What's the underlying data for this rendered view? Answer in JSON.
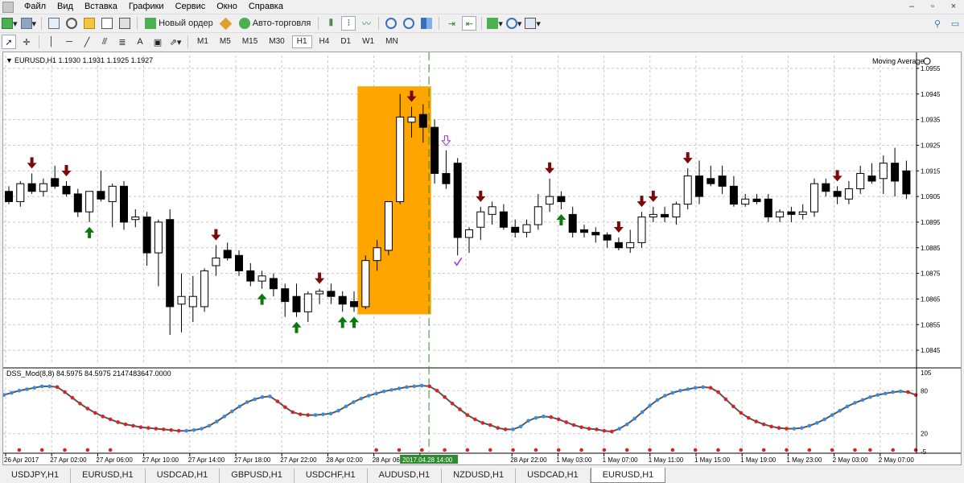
{
  "menu": {
    "items": [
      "Файл",
      "Вид",
      "Вставка",
      "Графики",
      "Сервис",
      "Окно",
      "Справка"
    ],
    "window_controls": [
      "–",
      "▫",
      "×"
    ]
  },
  "toolbar1": {
    "new_order": "Новый ордер",
    "auto_trading": "Авто-торговля"
  },
  "toolbar2": {
    "timeframes": [
      "M1",
      "M5",
      "M15",
      "M30",
      "H1",
      "H4",
      "D1",
      "W1",
      "MN"
    ],
    "active_timeframe": "H1"
  },
  "chart": {
    "header": "EURUSD,H1  1.1930 1.1931 1.1925 1.1927",
    "indicator_label": "Moving Average",
    "price_labels": [
      "1.0955",
      "1.0945",
      "1.0935",
      "1.0925",
      "1.0915",
      "1.0905",
      "1.0895",
      "1.0885",
      "1.0875",
      "1.0865",
      "1.0855",
      "1.0845"
    ],
    "time_labels": [
      "26 Apr 2017",
      "27 Apr 02:00",
      "27 Apr 06:00",
      "27 Apr 10:00",
      "27 Apr 14:00",
      "27 Apr 18:00",
      "27 Apr 22:00",
      "28 Apr 02:00",
      "28 Apr 06:00",
      "28 Apr",
      "1 May 03:00",
      "1 May 07:00",
      "1 May 11:00",
      "1 May 15:00",
      "1 May 19:00",
      "1 May 23:00",
      "2 May 03:00",
      "2 May 07:00",
      "28 Apr 22:00"
    ],
    "time_highlight": "2017.04.28 14:00",
    "osc_label": "DSS_Mod(8,8) 84.5975 84.5975 2147483647.0000",
    "osc_scale_labels": [
      "105",
      "80",
      "20",
      "-5"
    ],
    "colors": {
      "bull": "#ffffff",
      "bear": "#000000",
      "up_arrow": "#0a7a0a",
      "down_arrow": "#7a0a0a",
      "highlight": "#ffa500",
      "osc_line": "#555555",
      "osc_up": "#3a8be0",
      "osc_down": "#e02020"
    }
  },
  "chart_data": {
    "type": "candlestick",
    "instrument": "EURUSD",
    "timeframe": "H1",
    "ylim": [
      1.084,
      1.096
    ],
    "candles": [
      {
        "o": 1.0907,
        "h": 1.0909,
        "l": 1.0902,
        "c": 1.0903
      },
      {
        "o": 1.0903,
        "h": 1.0911,
        "l": 1.0901,
        "c": 1.091
      },
      {
        "o": 1.091,
        "h": 1.0914,
        "l": 1.0906,
        "c": 1.0907
      },
      {
        "o": 1.0907,
        "h": 1.0912,
        "l": 1.0905,
        "c": 1.091
      },
      {
        "o": 1.0912,
        "h": 1.0917,
        "l": 1.0908,
        "c": 1.0909
      },
      {
        "o": 1.0909,
        "h": 1.0911,
        "l": 1.0905,
        "c": 1.0906
      },
      {
        "o": 1.0906,
        "h": 1.0908,
        "l": 1.0897,
        "c": 1.0899
      },
      {
        "o": 1.0899,
        "h": 1.0903,
        "l": 1.0895,
        "c": 1.0907
      },
      {
        "o": 1.0907,
        "h": 1.0915,
        "l": 1.0903,
        "c": 1.0904
      },
      {
        "o": 1.0903,
        "h": 1.091,
        "l": 1.0893,
        "c": 1.0909
      },
      {
        "o": 1.0909,
        "h": 1.0911,
        "l": 1.0892,
        "c": 1.0895
      },
      {
        "o": 1.0896,
        "h": 1.09,
        "l": 1.0893,
        "c": 1.0897
      },
      {
        "o": 1.0897,
        "h": 1.0899,
        "l": 1.0878,
        "c": 1.0883
      },
      {
        "o": 1.0883,
        "h": 1.0896,
        "l": 1.087,
        "c": 1.0895
      },
      {
        "o": 1.0896,
        "h": 1.09,
        "l": 1.0851,
        "c": 1.0862
      },
      {
        "o": 1.0863,
        "h": 1.0875,
        "l": 1.0852,
        "c": 1.0866
      },
      {
        "o": 1.0862,
        "h": 1.0874,
        "l": 1.0856,
        "c": 1.0866
      },
      {
        "o": 1.0862,
        "h": 1.0877,
        "l": 1.086,
        "c": 1.0876
      },
      {
        "o": 1.0878,
        "h": 1.0886,
        "l": 1.0874,
        "c": 1.0881
      },
      {
        "o": 1.0884,
        "h": 1.0887,
        "l": 1.088,
        "c": 1.0881
      },
      {
        "o": 1.0882,
        "h": 1.0884,
        "l": 1.0874,
        "c": 1.0876
      },
      {
        "o": 1.0876,
        "h": 1.0879,
        "l": 1.087,
        "c": 1.0872
      },
      {
        "o": 1.0872,
        "h": 1.0876,
        "l": 1.0869,
        "c": 1.0874
      },
      {
        "o": 1.0873,
        "h": 1.0875,
        "l": 1.0866,
        "c": 1.0869
      },
      {
        "o": 1.0869,
        "h": 1.0871,
        "l": 1.0858,
        "c": 1.0864
      },
      {
        "o": 1.0866,
        "h": 1.0871,
        "l": 1.0858,
        "c": 1.086
      },
      {
        "o": 1.086,
        "h": 1.0868,
        "l": 1.0856,
        "c": 1.0867
      },
      {
        "o": 1.0867,
        "h": 1.0869,
        "l": 1.0863,
        "c": 1.0868
      },
      {
        "o": 1.0868,
        "h": 1.0871,
        "l": 1.0863,
        "c": 1.0866
      },
      {
        "o": 1.0866,
        "h": 1.0868,
        "l": 1.086,
        "c": 1.0863
      },
      {
        "o": 1.0864,
        "h": 1.0868,
        "l": 1.086,
        "c": 1.0862
      },
      {
        "o": 1.0862,
        "h": 1.0882,
        "l": 1.0861,
        "c": 1.088
      },
      {
        "o": 1.088,
        "h": 1.0888,
        "l": 1.0876,
        "c": 1.0885
      },
      {
        "o": 1.0884,
        "h": 1.0894,
        "l": 1.0882,
        "c": 1.0903
      },
      {
        "o": 1.0903,
        "h": 1.0945,
        "l": 1.0902,
        "c": 1.0936
      },
      {
        "o": 1.0934,
        "h": 1.094,
        "l": 1.0928,
        "c": 1.0936
      },
      {
        "o": 1.0937,
        "h": 1.0941,
        "l": 1.0926,
        "c": 1.0932
      },
      {
        "o": 1.0932,
        "h": 1.0935,
        "l": 1.091,
        "c": 1.0914
      },
      {
        "o": 1.0914,
        "h": 1.0923,
        "l": 1.0908,
        "c": 1.091
      },
      {
        "o": 1.0918,
        "h": 1.092,
        "l": 1.0882,
        "c": 1.0889
      },
      {
        "o": 1.0889,
        "h": 1.0893,
        "l": 1.0883,
        "c": 1.0892
      },
      {
        "o": 1.0893,
        "h": 1.0901,
        "l": 1.0888,
        "c": 1.0899
      },
      {
        "o": 1.0898,
        "h": 1.0903,
        "l": 1.0894,
        "c": 1.0901
      },
      {
        "o": 1.0899,
        "h": 1.0902,
        "l": 1.0892,
        "c": 1.0893
      },
      {
        "o": 1.0893,
        "h": 1.0896,
        "l": 1.0889,
        "c": 1.0891
      },
      {
        "o": 1.0891,
        "h": 1.0896,
        "l": 1.0889,
        "c": 1.0894
      },
      {
        "o": 1.0894,
        "h": 1.0906,
        "l": 1.0892,
        "c": 1.0901
      },
      {
        "o": 1.0902,
        "h": 1.0912,
        "l": 1.0899,
        "c": 1.0905
      },
      {
        "o": 1.0905,
        "h": 1.0907,
        "l": 1.09,
        "c": 1.0903
      },
      {
        "o": 1.0898,
        "h": 1.0901,
        "l": 1.0889,
        "c": 1.0891
      },
      {
        "o": 1.0892,
        "h": 1.0894,
        "l": 1.0889,
        "c": 1.0891
      },
      {
        "o": 1.0891,
        "h": 1.0893,
        "l": 1.0887,
        "c": 1.089
      },
      {
        "o": 1.089,
        "h": 1.0891,
        "l": 1.0885,
        "c": 1.0888
      },
      {
        "o": 1.0887,
        "h": 1.0889,
        "l": 1.0884,
        "c": 1.0885
      },
      {
        "o": 1.0885,
        "h": 1.0892,
        "l": 1.0883,
        "c": 1.0887
      },
      {
        "o": 1.0887,
        "h": 1.0899,
        "l": 1.0885,
        "c": 1.0897
      },
      {
        "o": 1.0897,
        "h": 1.0901,
        "l": 1.0895,
        "c": 1.0898
      },
      {
        "o": 1.0898,
        "h": 1.0901,
        "l": 1.0895,
        "c": 1.0897
      },
      {
        "o": 1.0897,
        "h": 1.0903,
        "l": 1.0894,
        "c": 1.0902
      },
      {
        "o": 1.0902,
        "h": 1.0916,
        "l": 1.09,
        "c": 1.0913
      },
      {
        "o": 1.0913,
        "h": 1.0919,
        "l": 1.0902,
        "c": 1.0905
      },
      {
        "o": 1.0912,
        "h": 1.0917,
        "l": 1.0909,
        "c": 1.091
      },
      {
        "o": 1.0913,
        "h": 1.0917,
        "l": 1.0906,
        "c": 1.0909
      },
      {
        "o": 1.0909,
        "h": 1.0913,
        "l": 1.0901,
        "c": 1.0902
      },
      {
        "o": 1.0902,
        "h": 1.0906,
        "l": 1.0901,
        "c": 1.0904
      },
      {
        "o": 1.0904,
        "h": 1.0906,
        "l": 1.0902,
        "c": 1.0903
      },
      {
        "o": 1.0904,
        "h": 1.0906,
        "l": 1.0895,
        "c": 1.0897
      },
      {
        "o": 1.0897,
        "h": 1.09,
        "l": 1.0895,
        "c": 1.0899
      },
      {
        "o": 1.0899,
        "h": 1.0901,
        "l": 1.0895,
        "c": 1.0898
      },
      {
        "o": 1.0898,
        "h": 1.0902,
        "l": 1.0896,
        "c": 1.0899
      },
      {
        "o": 1.0899,
        "h": 1.0912,
        "l": 1.0897,
        "c": 1.091
      },
      {
        "o": 1.091,
        "h": 1.0912,
        "l": 1.0905,
        "c": 1.0907
      },
      {
        "o": 1.0907,
        "h": 1.0909,
        "l": 1.0902,
        "c": 1.0905
      },
      {
        "o": 1.0904,
        "h": 1.0911,
        "l": 1.0902,
        "c": 1.0908
      },
      {
        "o": 1.0908,
        "h": 1.0917,
        "l": 1.0906,
        "c": 1.0914
      },
      {
        "o": 1.0913,
        "h": 1.0918,
        "l": 1.091,
        "c": 1.0911
      },
      {
        "o": 1.0912,
        "h": 1.0921,
        "l": 1.0906,
        "c": 1.0918
      },
      {
        "o": 1.0918,
        "h": 1.0924,
        "l": 1.0905,
        "c": 1.0911
      },
      {
        "o": 1.0915,
        "h": 1.0919,
        "l": 1.0904,
        "c": 1.0906
      }
    ],
    "highlight_range": {
      "from_index": 31,
      "to_index": 36
    },
    "vline_index": 37,
    "up_arrows": [
      7,
      22,
      25,
      29,
      30,
      48
    ],
    "down_arrows": [
      2,
      5,
      18,
      27,
      35,
      41,
      47,
      53,
      55,
      56,
      59,
      72
    ],
    "hollow_down_arrows": [
      38
    ],
    "check_marks": [
      39
    ],
    "oscillator": {
      "ylim": [
        -5,
        105
      ],
      "values": [
        74,
        77,
        80,
        82,
        84,
        86,
        86,
        85,
        78,
        70,
        62,
        55,
        49,
        44,
        40,
        36,
        33,
        31,
        29,
        28,
        27,
        26,
        25,
        24,
        24,
        25,
        27,
        31,
        37,
        44,
        51,
        58,
        64,
        68,
        71,
        72,
        65,
        57,
        50,
        47,
        46,
        46,
        47,
        48,
        52,
        58,
        64,
        69,
        73,
        76,
        79,
        81,
        83,
        85,
        86,
        87,
        86,
        80,
        71,
        62,
        54,
        46,
        40,
        35,
        32,
        28,
        26,
        26,
        30,
        38,
        42,
        44,
        43,
        40,
        36,
        32,
        29,
        27,
        26,
        24,
        23,
        27,
        33,
        41,
        50,
        59,
        67,
        73,
        77,
        80,
        82,
        84,
        85,
        84,
        78,
        68,
        58,
        49,
        42,
        37,
        33,
        30,
        28,
        27,
        27,
        28,
        31,
        35,
        40,
        46,
        52,
        58,
        63,
        67,
        71,
        74,
        76,
        78,
        79,
        78,
        74
      ]
    },
    "osc_baseline_dots": [
      2,
      5,
      8,
      11,
      14,
      49,
      52,
      55,
      58,
      61,
      64,
      67,
      70,
      73,
      76,
      79,
      82,
      85,
      88,
      91,
      94,
      97,
      100,
      103,
      106,
      109,
      112,
      114,
      117,
      120
    ]
  },
  "tabs": {
    "items": [
      "USDJPY,H1",
      "EURUSD,H1",
      "USDCAD,H1",
      "GBPUSD,H1",
      "USDCHF,H1",
      "AUDUSD,H1",
      "NZDUSD,H1",
      "USDCAD,H1",
      "EURUSD,H1"
    ],
    "active": 8
  }
}
